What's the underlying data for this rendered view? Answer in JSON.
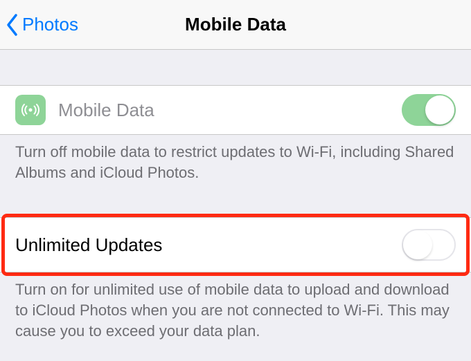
{
  "nav": {
    "back_label": "Photos",
    "title": "Mobile Data"
  },
  "sections": {
    "mobile_data": {
      "label": "Mobile Data",
      "toggle_on": true,
      "footer": "Turn off mobile data to restrict updates to Wi-Fi, including Shared Albums and iCloud Photos."
    },
    "unlimited_updates": {
      "label": "Unlimited Updates",
      "toggle_on": false,
      "footer": "Turn on for unlimited use of mobile data to upload and download to iCloud Photos when you are not connected to Wi-Fi. This may cause you to exceed your data plan."
    }
  },
  "colors": {
    "accent": "#007aff",
    "toggle_on": "#8ed498",
    "highlight": "#ff2a12"
  }
}
